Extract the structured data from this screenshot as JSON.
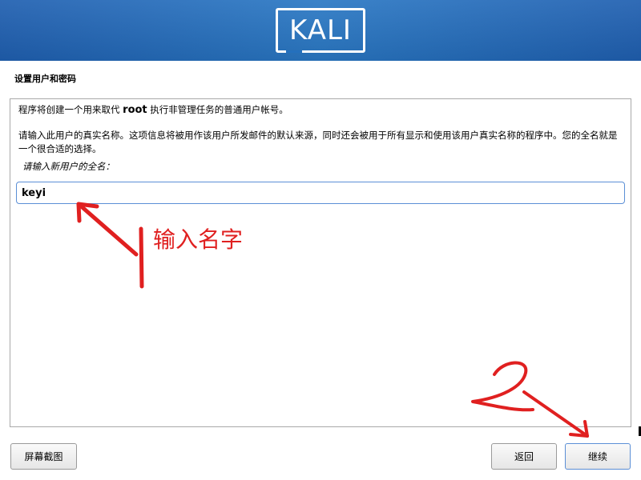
{
  "banner": {
    "logo_text": "KALI"
  },
  "step": {
    "title": "设置用户和密码"
  },
  "panel": {
    "para1_before": "程序将创建一个用来取代 ",
    "para1_bold": "root",
    "para1_after": " 执行非管理任务的普通用户帐号。",
    "para2": "请输入此用户的真实名称。这项信息将被用作该用户所发邮件的默认来源，同时还会被用于所有显示和使用该用户真实名称的程序中。您的全名就是一个很合适的选择。",
    "prompt": "请输入新用户的全名："
  },
  "name_input": {
    "value": "keyi"
  },
  "buttons": {
    "screenshot": "屏幕截图",
    "back": "返回",
    "continue": "继续"
  },
  "annotations": {
    "label1": "输入名字",
    "color": "#e02020"
  }
}
